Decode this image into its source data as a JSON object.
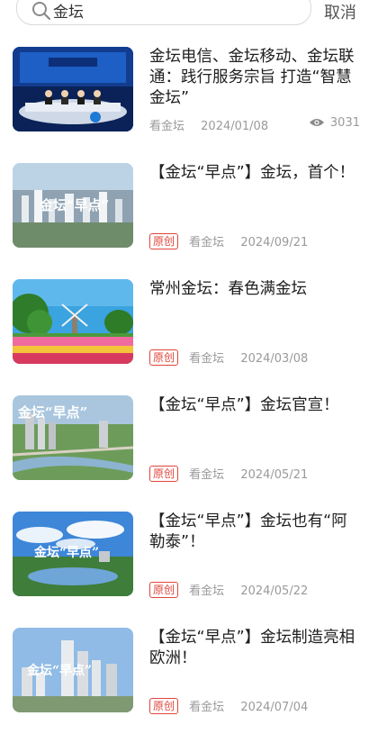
{
  "search": {
    "value": "金坛",
    "cancel_label": "取消"
  },
  "articles": [
    {
      "title": "金坛电信、金坛移动、金坛联通：践行服务宗旨 打造“智慧金坛”",
      "source": "看金坛",
      "date": "2024/01/08",
      "views": "3031",
      "badge": "",
      "thumb": "news-studio"
    },
    {
      "title": "【金坛“早点”】金坛，首个！",
      "source": "看金坛",
      "date": "2024/09/21",
      "views": "",
      "badge": "原创",
      "thumb": "city-aerial",
      "thumb_caption": "金坛“早点”"
    },
    {
      "title": "常州金坛：春色满金坛",
      "source": "看金坛",
      "date": "2024/03/08",
      "views": "",
      "badge": "原创",
      "thumb": "windmill-tulips"
    },
    {
      "title": "【金坛“早点”】金坛官宣！",
      "source": "看金坛",
      "date": "2024/05/21",
      "views": "",
      "badge": "原创",
      "thumb": "river-city",
      "thumb_caption": "金坛“早点”"
    },
    {
      "title": "【金坛“早点”】金坛也有“阿勒泰”！",
      "source": "看金坛",
      "date": "2024/05/22",
      "views": "",
      "badge": "原创",
      "thumb": "sky-lake",
      "thumb_caption": "金坛“早点”"
    },
    {
      "title": "【金坛“早点”】金坛制造亮相欧洲！",
      "source": "看金坛",
      "date": "2024/07/04",
      "views": "",
      "badge": "原创",
      "thumb": "towers",
      "thumb_caption": "金坛“早点”"
    }
  ]
}
